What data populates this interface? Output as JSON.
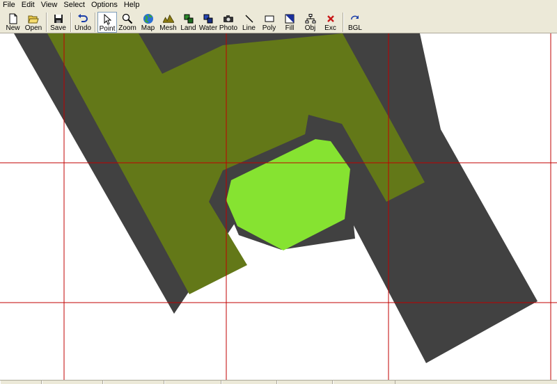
{
  "menu": [
    "File",
    "Edit",
    "View",
    "Select",
    "Options",
    "Help"
  ],
  "toolbar": {
    "new": "New",
    "open": "Open",
    "save": "Save",
    "undo": "Undo",
    "point": "Point",
    "zoom": "Zoom",
    "map": "Map",
    "mesh": "Mesh",
    "land": "Land",
    "water": "Water",
    "photo": "Photo",
    "line": "Line",
    "poly": "Poly",
    "fill": "Fill",
    "obj": "Obj",
    "exc": "Exc",
    "bgl": "BGL"
  },
  "icons": {
    "new": "new-file-icon",
    "open": "open-folder-icon",
    "save": "floppy-disk-icon",
    "undo": "undo-arrow-icon",
    "point": "cursor-arrow-icon",
    "zoom": "magnifier-icon",
    "map": "globe-icon",
    "mesh": "mountain-icon",
    "land": "land-squares-icon",
    "water": "water-squares-icon",
    "photo": "camera-icon",
    "line": "line-icon",
    "poly": "rectangle-icon",
    "fill": "fill-icon",
    "obj": "object-tree-icon",
    "exc": "red-x-icon",
    "bgl": "refresh-icon"
  },
  "colors": {
    "background": "#ffffff",
    "dark_area": "#414141",
    "olive_area": "#637818",
    "green_area": "#86e331",
    "grid_line": "#c00000",
    "chrome": "#ece9d8"
  },
  "status": [
    "",
    "",
    "",
    "",
    "",
    "",
    ""
  ]
}
